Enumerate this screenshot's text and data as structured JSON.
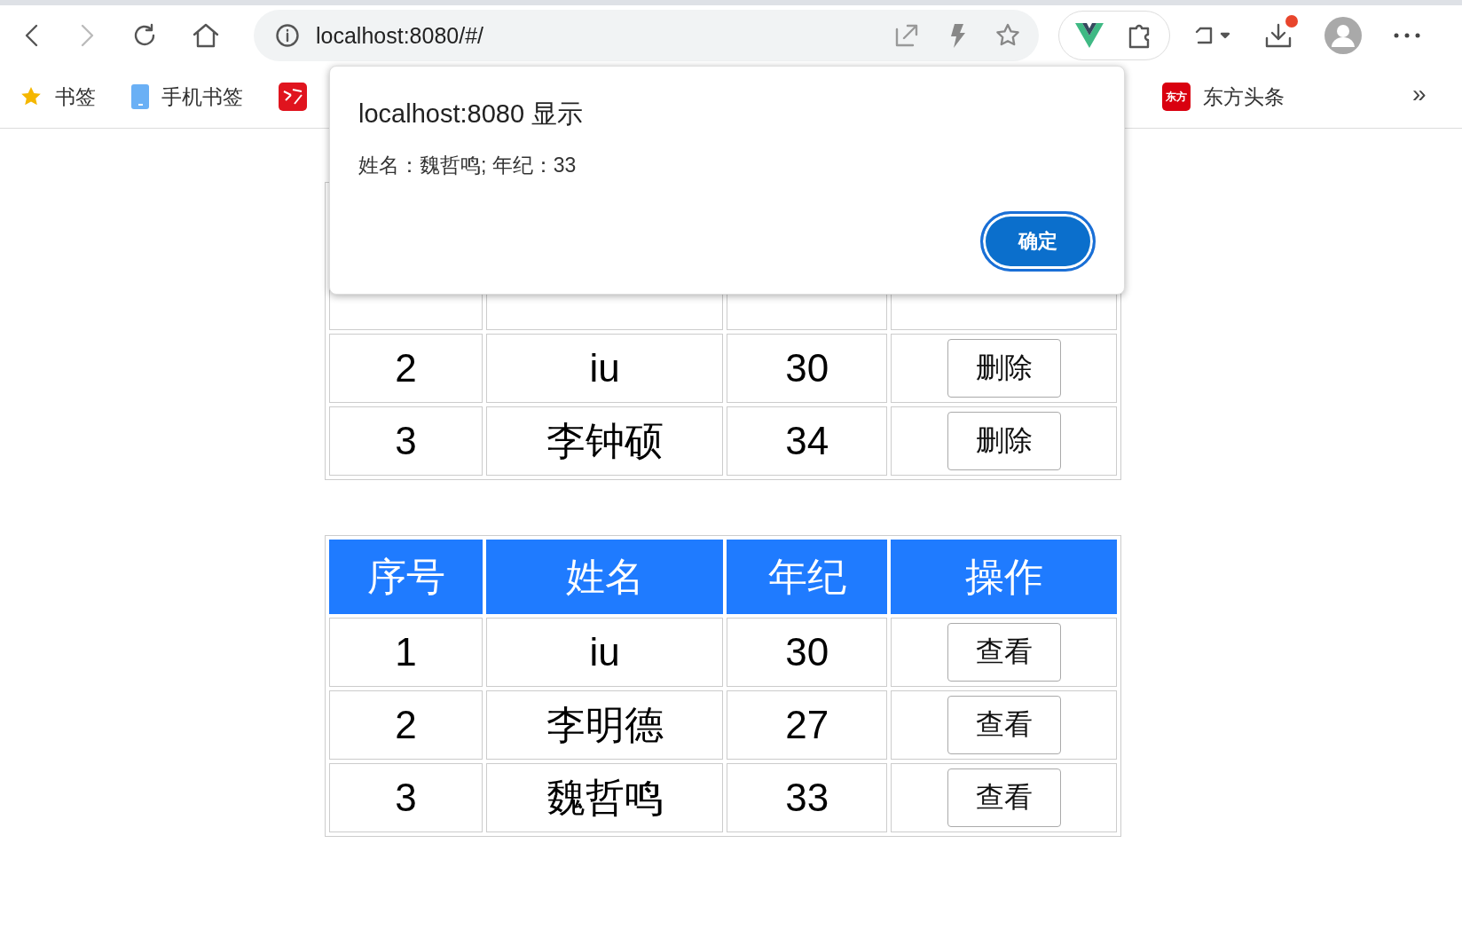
{
  "browser": {
    "back_enabled": true,
    "forward_enabled": false,
    "address": "localhost:8080/#/",
    "download_badge": true,
    "bookmarks": [
      {
        "kind": "star",
        "label": "书签"
      },
      {
        "kind": "phone",
        "label": "手机书签"
      },
      {
        "kind": "logo"
      },
      {
        "kind": "text-logo",
        "icon_text": "东方",
        "label": "东方头条"
      }
    ],
    "bookmarks_overflow": "»"
  },
  "tables": [
    {
      "rows": [
        {
          "cells": [
            "2",
            "iu",
            "30"
          ],
          "action": "删除"
        },
        {
          "cells": [
            "3",
            "李钟硕",
            "34"
          ],
          "action": "删除"
        }
      ]
    },
    {
      "columns": [
        "序号",
        "姓名",
        "年纪",
        "操作"
      ],
      "rows": [
        {
          "cells": [
            "1",
            "iu",
            "30"
          ],
          "action": "查看"
        },
        {
          "cells": [
            "2",
            "李明德",
            "27"
          ],
          "action": "查看"
        },
        {
          "cells": [
            "3",
            "魏哲鸣",
            "33"
          ],
          "action": "查看"
        }
      ]
    }
  ],
  "dialog": {
    "title": "localhost:8080 显示",
    "message": "姓名：魏哲鸣; 年纪：33",
    "button": "确定"
  }
}
